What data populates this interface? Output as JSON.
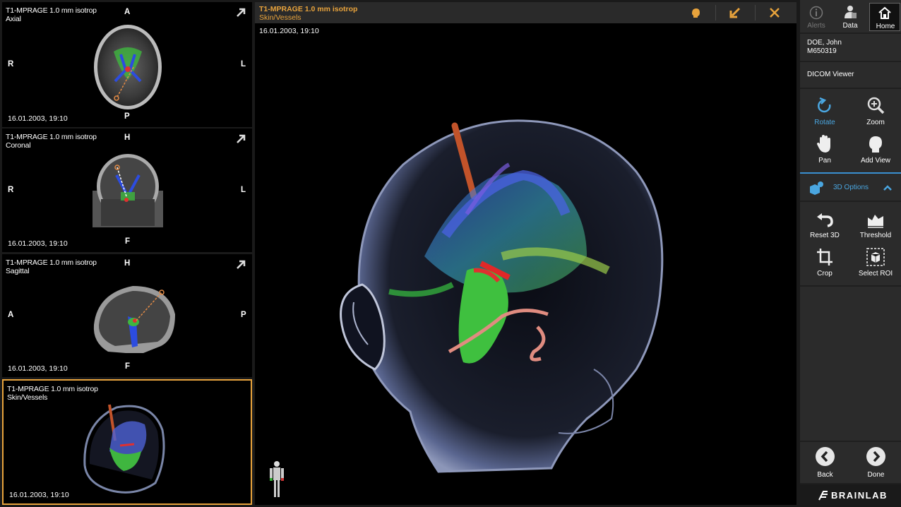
{
  "thumbnails": [
    {
      "series": "T1-MPRAGE 1.0 mm isotrop",
      "view": "Axial",
      "date": "16.01.2003, 19:10",
      "top": "A",
      "bottom": "P",
      "left": "R",
      "right": "L"
    },
    {
      "series": "T1-MPRAGE 1.0 mm isotrop",
      "view": "Coronal",
      "date": "16.01.2003, 19:10",
      "top": "H",
      "bottom": "F",
      "left": "R",
      "right": "L"
    },
    {
      "series": "T1-MPRAGE 1.0 mm isotrop",
      "view": "Sagittal",
      "date": "16.01.2003, 19:10",
      "top": "H",
      "bottom": "F",
      "left": "A",
      "right": "P"
    },
    {
      "series": "T1-MPRAGE 1.0 mm isotrop",
      "view": "Skin/Vessels",
      "date": "16.01.2003, 19:10"
    }
  ],
  "main": {
    "series": "T1-MPRAGE 1.0 mm isotrop",
    "view": "Skin/Vessels",
    "date": "16.01.2003, 19:10",
    "icons": [
      "head-icon",
      "minimize-icon",
      "close-icon"
    ]
  },
  "topbar": {
    "alerts": "Alerts",
    "data": "Data",
    "home": "Home"
  },
  "patient": {
    "name": "DOE, John",
    "id": "M650319"
  },
  "viewer_label": "DICOM Viewer",
  "tools": {
    "rotate": "Rotate",
    "zoom": "Zoom",
    "pan": "Pan",
    "add_view": "Add View"
  },
  "options": {
    "title": "3D Options",
    "reset": "Reset 3D",
    "threshold": "Threshold",
    "crop": "Crop",
    "select_roi": "Select ROI"
  },
  "nav": {
    "back": "Back",
    "done": "Done"
  },
  "brand": "BRAINLAB",
  "colors": {
    "accent": "#e8a33c",
    "active_blue": "#4aa6e0",
    "panel": "#2b2b2b"
  }
}
